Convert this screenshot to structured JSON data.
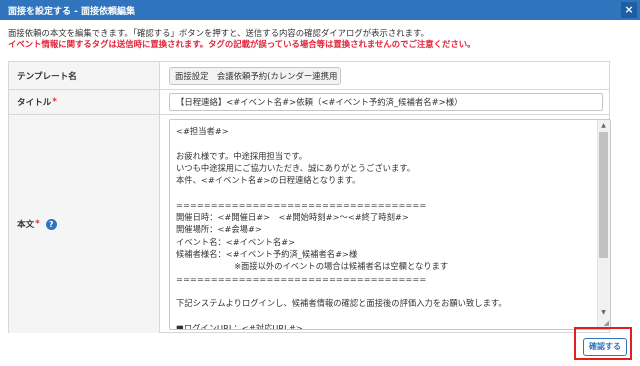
{
  "dialog": {
    "title": "面接を設定する - 面接依頼編集",
    "close_label": "×"
  },
  "description": "面接依頼の本文を編集できます。「確認する」ボタンを押すと、送信する内容の確認ダイアログが表示されます。",
  "warning": "イベント情報に関するタグは送信時に置換されます。タグの記載が誤っている場合等は置換されませんのでご注意ください。",
  "form": {
    "template_label": "テンプレート名",
    "template_value": "面接設定　会議依頼予約(カレンダー連携用",
    "title_label": "タイトル",
    "title_required": "*",
    "title_value": "【日程連絡】<#イベント名#>依頼（<#イベント予約済_候補者名#>様）",
    "body_label": "本文",
    "body_required": "*",
    "help_icon": "?",
    "body_value": "<#担当者#>\n\nお疲れ様です。中途採用担当です。\nいつも中途採用にご協力いただき、誠にありがとうございます。\n本件、<#イベント名#>の日程連絡となります。\n\n====================================\n開催日時：<#開催日#>　<#開始時刻#>〜<#終了時刻#>\n開催場所：<#会場#>\nイベント名：<#イベント名#>\n候補者様名：<#イベント予約済_候補者名#>様\n　　　　　　　※面接以外のイベントの場合は候補者名は空欄となります\n====================================\n\n下記システムよりログインし、候補者情報の確認と面接後の評価入力をお願い致します。\n\n■ログインURL：<#対応URL#>"
  },
  "buttons": {
    "confirm_label": "確認する"
  },
  "scrollbar": {
    "up_arrow": "▲",
    "down_arrow": "▼",
    "grip": "◢"
  }
}
